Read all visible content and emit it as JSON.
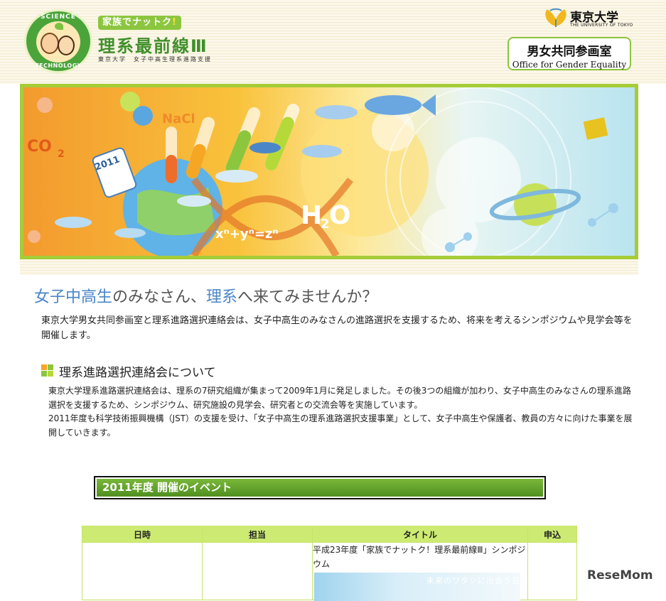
{
  "header": {
    "badge_top": "SCIENCE",
    "badge_bottom": "TECHNOLOGY",
    "tagline": "家族でナットク",
    "tagline_mark": "!",
    "brand_title": "理系最前線Ⅲ",
    "brand_sub": "東京大学　女子中高生理系進路支援",
    "university_name": "東京大学",
    "university_en": "THE UNIVERSITY OF TOKYO",
    "office_ja": "男女共同参画室",
    "office_en": "Office for Gender Equality"
  },
  "hero": {
    "labels": [
      "NaCl",
      "CO",
      "2",
      "2011",
      "H",
      "2",
      "O",
      "xⁿ+yⁿ=zⁿ"
    ]
  },
  "headline": {
    "part1": "女子中高生",
    "part2": "のみなさん、",
    "part3": "理系",
    "part4": "へ来てみませんか？"
  },
  "intro": "東京大学男女共同参画室と理系進路選択連絡会は、女子中高生のみなさんの進路選択を支援するため、将来を考えるシンポジウムや見学会等を開催します。",
  "section": {
    "title": "理系進路選択連絡会について",
    "para1": "東京大学理系進路選択連絡会は、理系の7研究組織が集まって2009年1月に発足しました。その後3つの組織が加わり、女子中高生のみなさんの理系進路選択を支援するため、シンポジウム、研究施設の見学会、研究者との交流会等を実施しています。",
    "para2": "2011年度も科学技術振興機構（JST）の支援を受け、「女子中高生の理系進路選択支援事業」として、女子中高生や保護者、教員の方々に向けた事業を展開していきます。"
  },
  "events": {
    "bar_title": "2011年度 開催のイベント",
    "headers": [
      "日時",
      "担当",
      "タイトル",
      "申込"
    ],
    "rows": [
      {
        "date": "",
        "org": "",
        "title": "平成23年度「家族でナットク！理系最前線Ⅲ」シンポジウム",
        "apply": "",
        "thumb_text": "未来のワタシに出会う日"
      }
    ]
  },
  "watermark": "ReseMom",
  "colors": {
    "accent_green": "#8cc63f",
    "headline_blue": "#4a86c8",
    "headline_green": "#5ba335",
    "table_header": "#cdeb72"
  }
}
